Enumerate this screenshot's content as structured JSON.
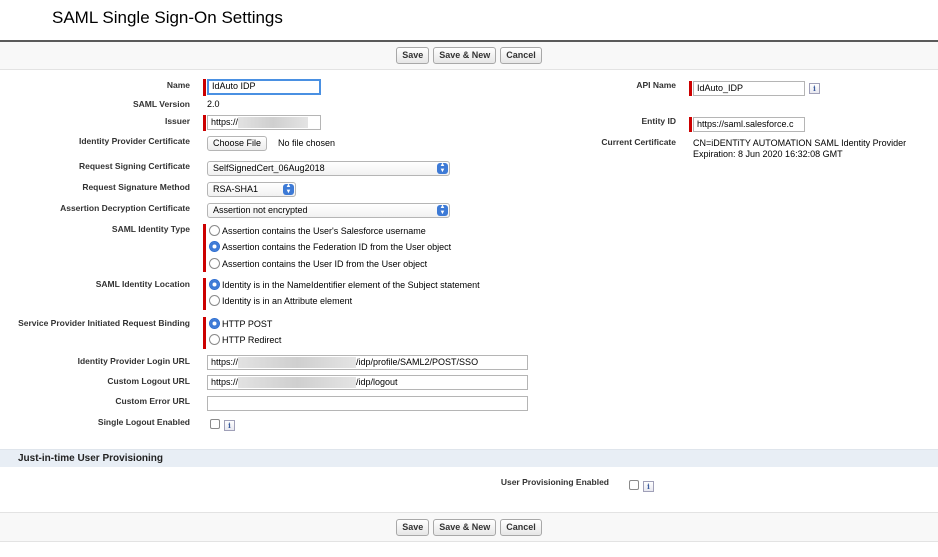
{
  "page": {
    "title": "SAML Single Sign-On Settings"
  },
  "buttons": {
    "save": "Save",
    "save_new": "Save & New",
    "cancel": "Cancel"
  },
  "fields": {
    "name": {
      "label": "Name",
      "value": "IdAuto IDP"
    },
    "api_name": {
      "label": "API Name",
      "value": "IdAuto_IDP"
    },
    "saml_version": {
      "label": "SAML Version",
      "value": "2.0"
    },
    "issuer": {
      "label": "Issuer",
      "value": "https://"
    },
    "entity_id": {
      "label": "Entity ID",
      "value": "https://saml.salesforce.c"
    },
    "idp_cert": {
      "label": "Identity Provider Certificate",
      "button": "Choose File",
      "status": "No file chosen"
    },
    "current_cert": {
      "label": "Current Certificate",
      "line1": "CN=iDENTiTY AUTOMATION SAML Identity Provider",
      "line2": "Expiration: 8 Jun 2020 16:32:08 GMT"
    },
    "req_sign_cert": {
      "label": "Request Signing Certificate",
      "value": "SelfSignedCert_06Aug2018"
    },
    "req_sign_method": {
      "label": "Request Signature Method",
      "value": "RSA-SHA1"
    },
    "assertion_decrypt": {
      "label": "Assertion Decryption Certificate",
      "value": "Assertion not encrypted"
    },
    "identity_type": {
      "label": "SAML Identity Type",
      "options": [
        "Assertion contains the User's Salesforce username",
        "Assertion contains the Federation ID from the User object",
        "Assertion contains the User ID from the User object"
      ],
      "selected": 1
    },
    "identity_location": {
      "label": "SAML Identity Location",
      "options": [
        "Identity is in the NameIdentifier element of the Subject statement",
        "Identity is in an Attribute element"
      ],
      "selected": 0
    },
    "sp_binding": {
      "label": "Service Provider Initiated Request Binding",
      "options": [
        "HTTP POST",
        "HTTP Redirect"
      ],
      "selected": 0
    },
    "idp_login_url": {
      "label": "Identity Provider Login URL",
      "prefix": "https://",
      "suffix": "/idp/profile/SAML2/POST/SSO"
    },
    "logout_url": {
      "label": "Custom Logout URL",
      "prefix": "https://",
      "suffix": "/idp/logout"
    },
    "error_url": {
      "label": "Custom Error URL",
      "value": ""
    },
    "single_logout": {
      "label": "Single Logout Enabled",
      "checked": false
    }
  },
  "jit": {
    "title": "Just-in-time User Provisioning",
    "user_provisioning": {
      "label": "User Provisioning Enabled",
      "checked": false
    }
  },
  "icons": {
    "info": "i",
    "chevron": "▲▼"
  },
  "colors": {
    "required": "#c00000",
    "select_accent": "#3d7ad6",
    "section_bg": "#e8eef5"
  }
}
